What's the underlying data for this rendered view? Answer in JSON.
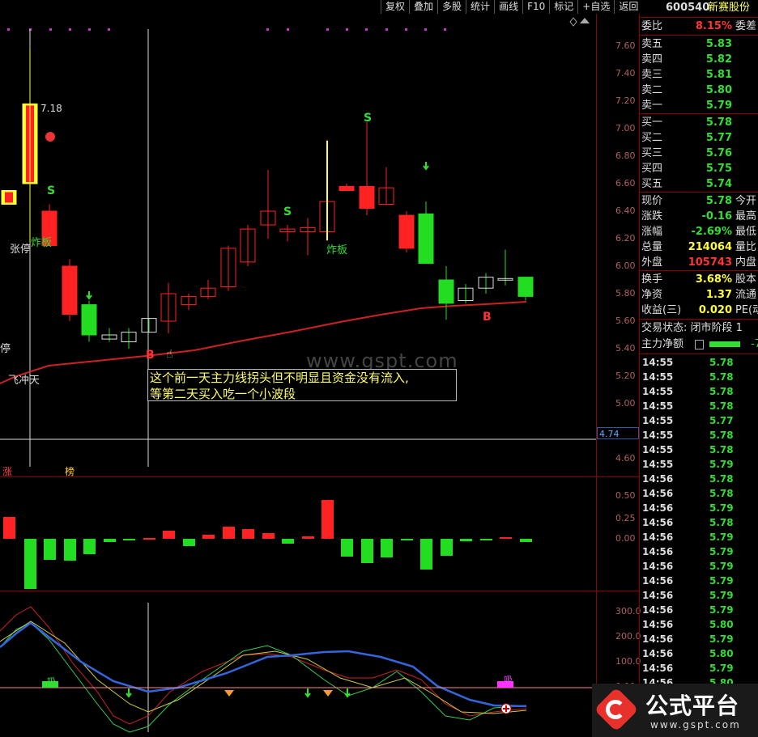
{
  "toolbar": {
    "buttons": [
      "复权",
      "叠加",
      "多股",
      "统计",
      "画线",
      "F10",
      "标记",
      "+自选",
      "返回"
    ]
  },
  "price_axis": [
    "7.60",
    "7.40",
    "7.20",
    "7.00",
    "6.80",
    "6.60",
    "6.40",
    "6.20",
    "6.00",
    "5.80",
    "5.60",
    "5.40",
    "5.20",
    "5.00",
    "4.60"
  ],
  "current_price_tag": "4.74",
  "macd_axis": [
    "0.50",
    "0.25",
    "0.00"
  ],
  "kdj_axis": [
    "300.0",
    "200.0",
    "100.0",
    "0.00"
  ],
  "chart_labels": {
    "high_price": "7.18",
    "zhangting": "张停",
    "zhaban1": "炸板",
    "zhaban2": "炸板",
    "feichongtian": "飞冲天",
    "ting": "停",
    "zhang": "涨",
    "bang": "榜",
    "s": "S",
    "b": "B",
    "ji": "吸",
    "ji2": "吸"
  },
  "annotation": {
    "line1": "这个前一天主力线拐头但不明显且资金没有流入,",
    "line2": "等第二天买入吃一个小波段"
  },
  "watermark": "www.gspt.com",
  "quote": {
    "code": "600540",
    "name": "新赛股份",
    "weibi_label": "委比",
    "weibi_value": "8.15%",
    "weicha_label": "委差",
    "asks": [
      {
        "label": "卖五",
        "price": "5.83"
      },
      {
        "label": "卖四",
        "price": "5.82"
      },
      {
        "label": "卖三",
        "price": "5.81"
      },
      {
        "label": "卖二",
        "price": "5.80"
      },
      {
        "label": "卖一",
        "price": "5.79"
      }
    ],
    "bids": [
      {
        "label": "买一",
        "price": "5.78"
      },
      {
        "label": "买二",
        "price": "5.77"
      },
      {
        "label": "买三",
        "price": "5.76"
      },
      {
        "label": "买四",
        "price": "5.75"
      },
      {
        "label": "买五",
        "price": "5.74"
      }
    ],
    "stats": [
      {
        "label": "现价",
        "value": "5.78",
        "extra": "今开",
        "color": "green"
      },
      {
        "label": "涨跌",
        "value": "-0.16",
        "extra": "最高",
        "color": "green"
      },
      {
        "label": "涨幅",
        "value": "-2.69%",
        "extra": "最低",
        "color": "green"
      },
      {
        "label": "总量",
        "value": "214064",
        "extra": "量比",
        "color": "yellow"
      },
      {
        "label": "外盘",
        "value": "105743",
        "extra": "内盘",
        "color": "red"
      }
    ],
    "stats2": [
      {
        "label": "换手",
        "value": "3.68%",
        "extra": "股本"
      },
      {
        "label": "净资",
        "value": "1.37",
        "extra": "流通"
      },
      {
        "label": "收益(三)",
        "value": "0.020",
        "extra": "PE(动"
      }
    ],
    "trade_status": "交易状态: 闭市阶段 1",
    "main_net_label": "主力净额",
    "main_net_value": "-7"
  },
  "ticks": [
    {
      "time": "14:55",
      "price": "5.78"
    },
    {
      "time": "14:55",
      "price": "5.78"
    },
    {
      "time": "14:55",
      "price": "5.78"
    },
    {
      "time": "14:55",
      "price": "5.78"
    },
    {
      "time": "14:55",
      "price": "5.77"
    },
    {
      "time": "14:55",
      "price": "5.78"
    },
    {
      "time": "14:55",
      "price": "5.78"
    },
    {
      "time": "14:55",
      "price": "5.79"
    },
    {
      "time": "14:56",
      "price": "5.78"
    },
    {
      "time": "14:56",
      "price": "5.78"
    },
    {
      "time": "14:56",
      "price": "5.79"
    },
    {
      "time": "14:56",
      "price": "5.78"
    },
    {
      "time": "14:56",
      "price": "5.79"
    },
    {
      "time": "14:56",
      "price": "5.79"
    },
    {
      "time": "14:56",
      "price": "5.79"
    },
    {
      "time": "14:56",
      "price": "5.79"
    },
    {
      "time": "14:56",
      "price": "5.79"
    },
    {
      "time": "14:56",
      "price": "5.79"
    },
    {
      "time": "14:56",
      "price": "5.80"
    },
    {
      "time": "14:56",
      "price": "5.79"
    },
    {
      "time": "14:56",
      "price": "5.80"
    },
    {
      "time": "14:56",
      "price": "5.79"
    },
    {
      "time": "14:56",
      "price": "5.80"
    }
  ],
  "logo": {
    "text": "公式平台",
    "url": "www.gspt.com"
  },
  "candles": [
    {
      "o": 6.45,
      "c": 6.55,
      "h": 6.55,
      "l": 6.45,
      "col": "yellow"
    },
    {
      "o": 6.6,
      "c": 7.18,
      "h": 7.18,
      "l": 6.3,
      "col": "yellow"
    },
    {
      "o": 6.15,
      "c": 6.4,
      "h": 6.45,
      "l": 6.15,
      "col": "red"
    },
    {
      "o": 6.0,
      "c": 5.65,
      "h": 6.05,
      "l": 5.6,
      "col": "red"
    },
    {
      "o": 5.5,
      "c": 5.72,
      "h": 5.75,
      "l": 5.45,
      "col": "green"
    },
    {
      "o": 5.47,
      "c": 5.5,
      "h": 5.55,
      "l": 5.45,
      "col": "green"
    },
    {
      "o": 5.45,
      "c": 5.52,
      "h": 5.55,
      "l": 5.4,
      "col": "green"
    },
    {
      "o": 5.52,
      "c": 5.62,
      "h": 5.62,
      "l": 5.52,
      "col": "green"
    },
    {
      "o": 5.6,
      "c": 5.8,
      "h": 5.88,
      "l": 5.51,
      "col": "red"
    },
    {
      "o": 5.72,
      "c": 5.78,
      "h": 5.8,
      "l": 5.68,
      "col": "red"
    },
    {
      "o": 5.78,
      "c": 5.84,
      "h": 5.9,
      "l": 5.76,
      "col": "red"
    },
    {
      "o": 5.85,
      "c": 6.13,
      "h": 6.15,
      "l": 5.82,
      "col": "red"
    },
    {
      "o": 6.03,
      "c": 6.27,
      "h": 6.3,
      "l": 6.0,
      "col": "red"
    },
    {
      "o": 6.3,
      "c": 6.4,
      "h": 6.7,
      "l": 6.2,
      "col": "red"
    },
    {
      "o": 6.25,
      "c": 6.27,
      "h": 6.3,
      "l": 6.18,
      "col": "red"
    },
    {
      "o": 6.25,
      "c": 6.28,
      "h": 6.35,
      "l": 6.08,
      "col": "red"
    },
    {
      "o": 6.25,
      "c": 6.47,
      "h": 6.92,
      "l": 6.18,
      "col": "red"
    },
    {
      "o": 6.55,
      "c": 6.58,
      "h": 6.6,
      "l": 6.55,
      "col": "red"
    },
    {
      "o": 6.42,
      "c": 6.58,
      "h": 7.05,
      "l": 6.37,
      "col": "red"
    },
    {
      "o": 6.45,
      "c": 6.57,
      "h": 6.72,
      "l": 6.45,
      "col": "red"
    },
    {
      "o": 6.37,
      "c": 6.13,
      "h": 6.4,
      "l": 6.1,
      "col": "red"
    },
    {
      "o": 6.38,
      "c": 6.02,
      "h": 6.47,
      "l": 6.02,
      "col": "green"
    },
    {
      "o": 5.9,
      "c": 5.73,
      "h": 6.0,
      "l": 5.61,
      "col": "green"
    },
    {
      "o": 5.75,
      "c": 5.84,
      "h": 5.87,
      "l": 5.73,
      "col": "green"
    },
    {
      "o": 5.84,
      "c": 5.92,
      "h": 5.95,
      "l": 5.8,
      "col": "green"
    },
    {
      "o": 5.91,
      "c": 5.91,
      "h": 6.12,
      "l": 5.86,
      "col": "green"
    },
    {
      "o": 5.92,
      "c": 5.78,
      "h": 5.92,
      "l": 5.75,
      "col": "green"
    }
  ],
  "macd_values": [
    0.27,
    -0.62,
    -0.26,
    -0.27,
    -0.19,
    -0.04,
    -0.01,
    0.01,
    0.1,
    -0.09,
    0.05,
    0.15,
    0.12,
    0.07,
    -0.06,
    0.03,
    0.48,
    -0.22,
    -0.3,
    -0.23,
    -0.01,
    -0.38,
    -0.21,
    -0.03,
    -0.01,
    0.02,
    -0.04
  ],
  "colors": {
    "up": "#ff2222",
    "down": "#22dd22",
    "zhangting": "#ffff33",
    "ma": "#cc2222"
  }
}
